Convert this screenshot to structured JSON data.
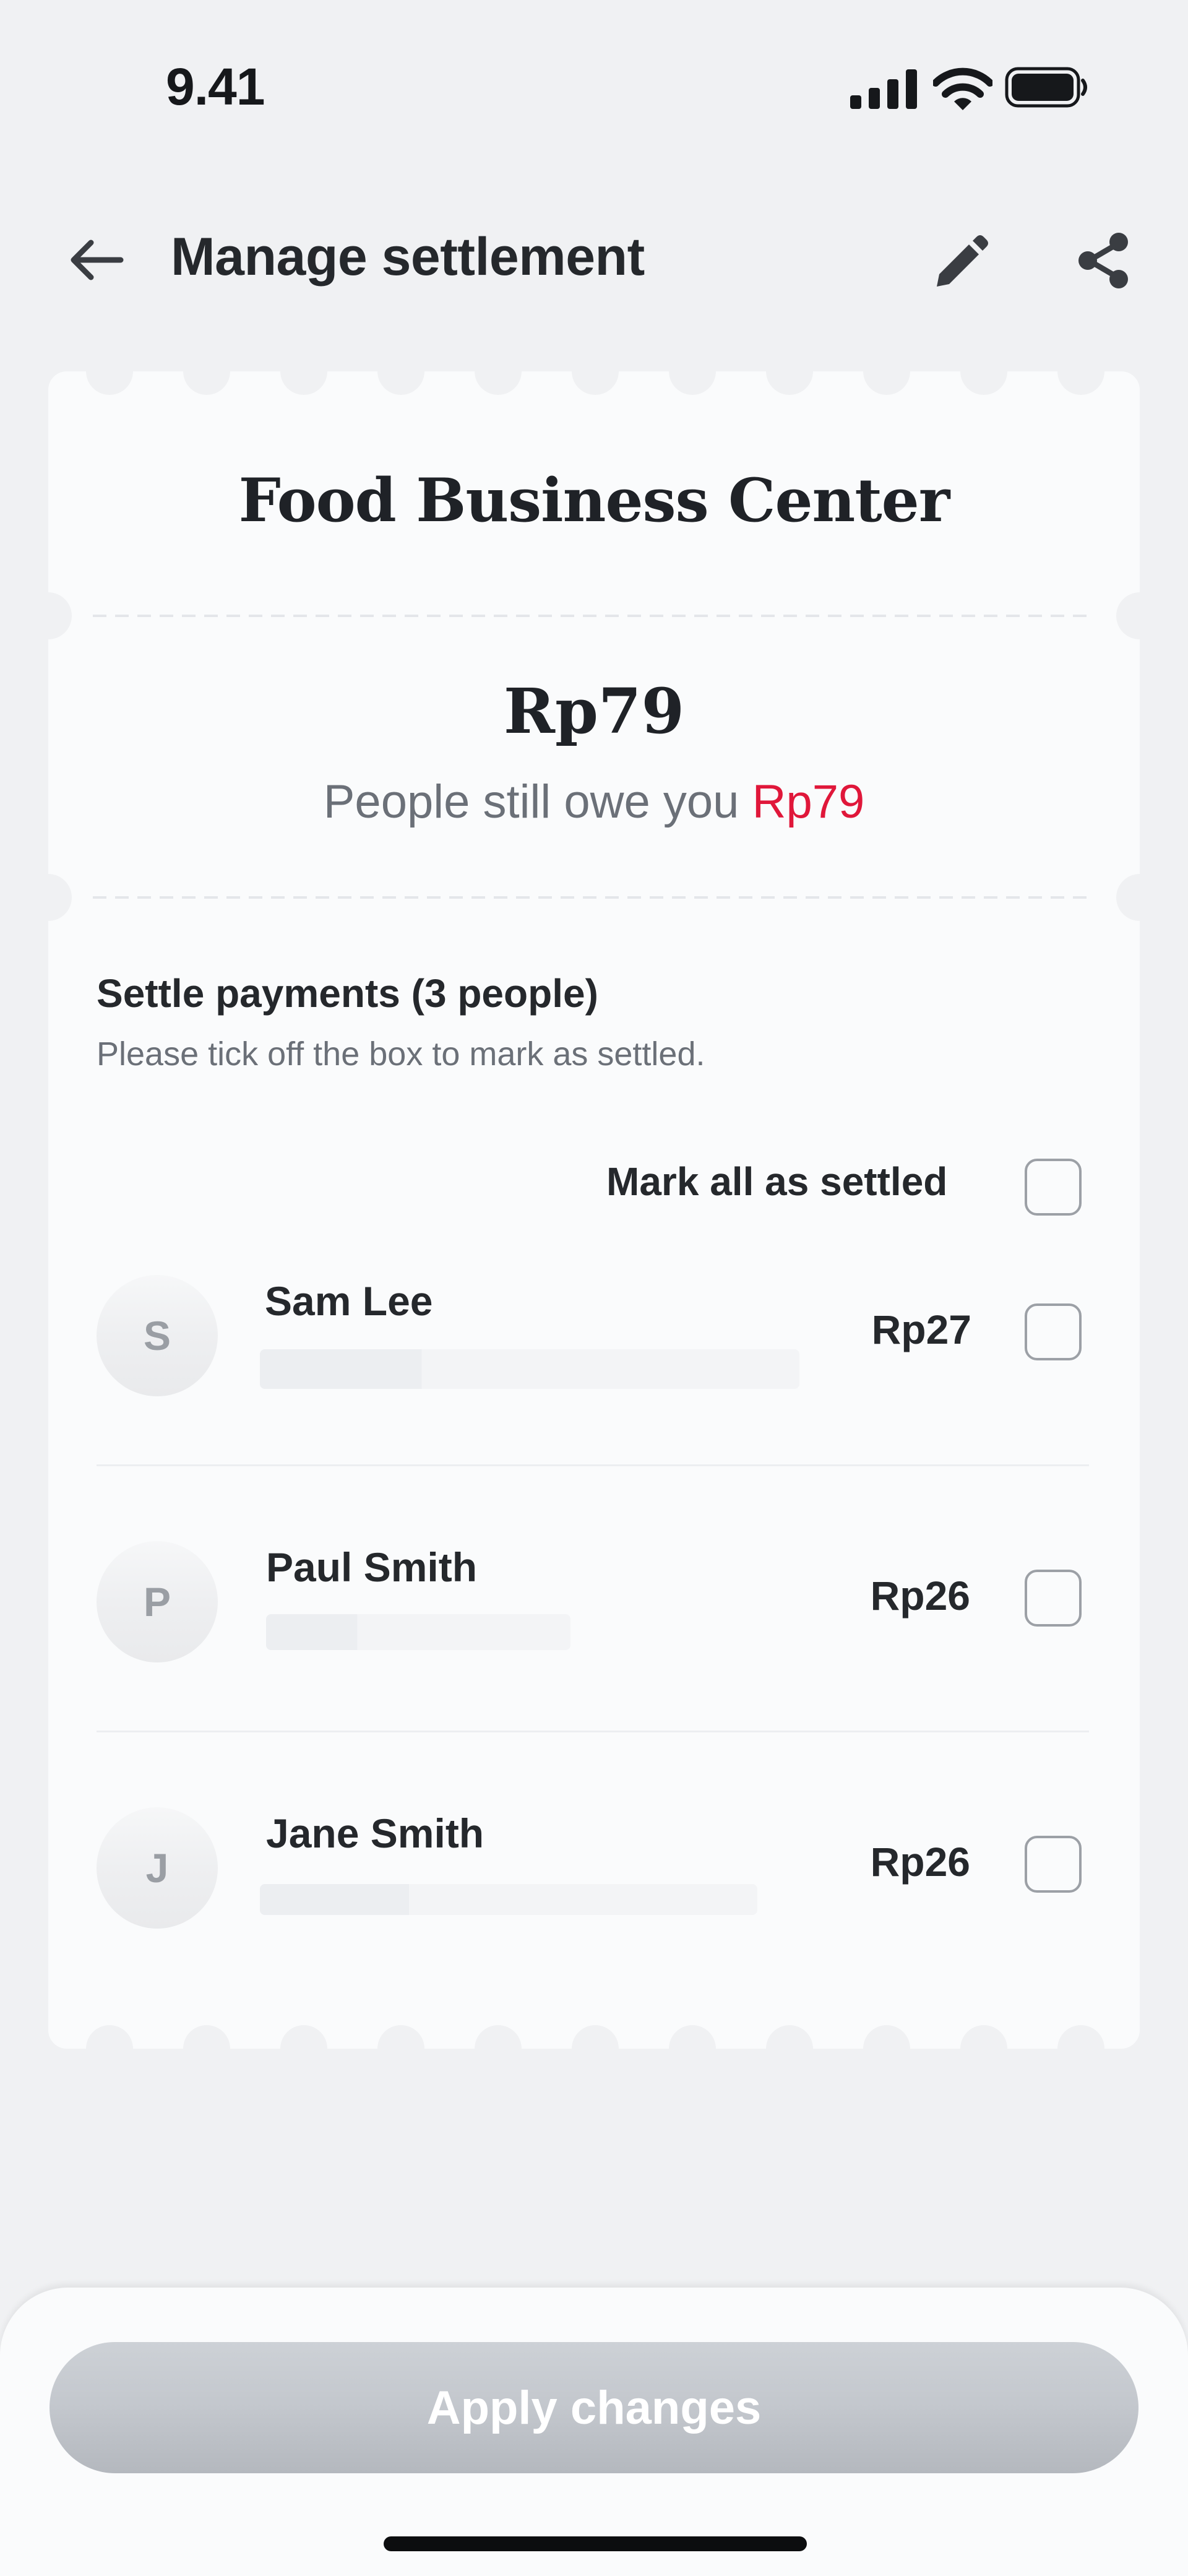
{
  "status_bar": {
    "time": "9.41"
  },
  "header": {
    "title": "Manage settlement"
  },
  "card": {
    "place_name": "Food Business Center",
    "total": "Rp79",
    "owe_prefix": "People still owe you ",
    "owe_amount": "Rp79"
  },
  "settle": {
    "title": "Settle payments (3 people)",
    "subtitle": "Please tick off the box to mark as settled.",
    "mark_all_label": "Mark all as settled",
    "people": [
      {
        "initial": "S",
        "name": "Sam Lee",
        "amount": "Rp27",
        "settled": false
      },
      {
        "initial": "P",
        "name": "Paul Smith",
        "amount": "Rp26",
        "settled": false
      },
      {
        "initial": "J",
        "name": "Jane Smith",
        "amount": "Rp26",
        "settled": false
      }
    ]
  },
  "footer": {
    "apply_label": "Apply changes"
  },
  "colors": {
    "background": "#f0f1f3",
    "card": "#fafbfc",
    "accent_red": "#e0173a",
    "text_primary": "#25282c",
    "text_secondary": "#6b7078",
    "button_disabled": "#c3c7cd"
  },
  "icons": {
    "back": "arrow-left-icon",
    "edit": "pencil-icon",
    "share": "share-icon",
    "signal": "signal-icon",
    "wifi": "wifi-icon",
    "battery": "battery-icon"
  }
}
